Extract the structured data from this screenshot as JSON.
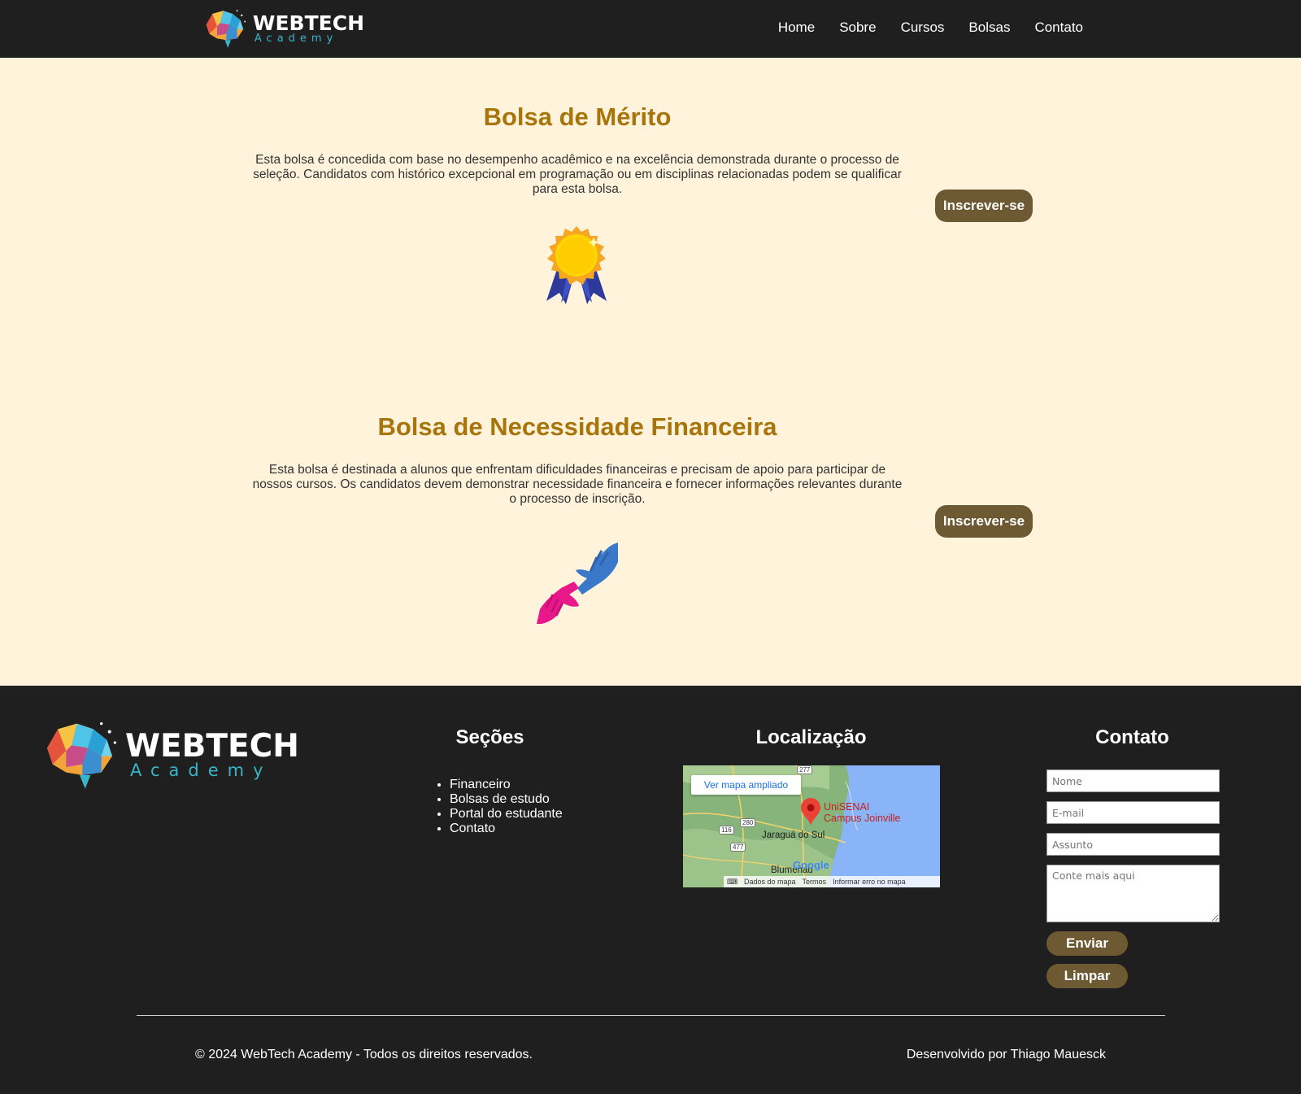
{
  "header": {
    "logo": {
      "word": "WEBTECH",
      "sub": "Academy"
    },
    "nav": [
      "Home",
      "Sobre",
      "Cursos",
      "Bolsas",
      "Contato"
    ]
  },
  "scholarships": [
    {
      "title": "Bolsa de Mérito",
      "description": "Esta bolsa é concedida com base no desempenho acadêmico e na excelência demonstrada durante o processo de seleção. Candidatos com histórico excepcional em programação ou em disciplinas relacionadas podem se qualificar para esta bolsa.",
      "button": "Inscrever-se",
      "icon": "medal-icon"
    },
    {
      "title": "Bolsa de Necessidade Financeira",
      "description": "Esta bolsa é destinada a alunos que enfrentam dificuldades financeiras e precisam de apoio para participar de nossos cursos. Os candidatos devem demonstrar necessidade financeira e fornecer informações relevantes durante o processo de inscrição.",
      "button": "Inscrever-se",
      "icon": "helping-hands-icon"
    }
  ],
  "footer": {
    "logo": {
      "word": "WEBTECH",
      "sub": "Academy"
    },
    "sections_title": "Seções",
    "sections": [
      "Financeiro",
      "Bolsas de estudo",
      "Portal do estudante",
      "Contato"
    ],
    "location_title": "Localização",
    "map": {
      "button": "Ver mapa ampliado",
      "marker_label_1": "UniSENAI",
      "marker_label_2": "Campus Joinville",
      "city_1": "Jaraguá do Sul",
      "city_2": "Blumenau",
      "logo": "Google",
      "road_1": "277",
      "road_2": "280",
      "road_3": "116",
      "road_4": "477",
      "footer_items": [
        "Dados do mapa",
        "Termos",
        "Informar erro no mapa"
      ]
    },
    "contact_title": "Contato",
    "form": {
      "name_placeholder": "Nome",
      "email_placeholder": "E-mail",
      "subject_placeholder": "Assunto",
      "message_placeholder": "Conte mais aqui",
      "send": "Enviar",
      "clear": "Limpar"
    },
    "copyright": "© 2024 WebTech Academy - Todos os direitos reservados.",
    "developer": "Desenvolvido por Thiago Mauesck"
  },
  "colors": {
    "header_bg": "#1f1f1f",
    "main_bg": "#fff3dc",
    "title": "#a8750d",
    "button": "#6e5a32"
  }
}
